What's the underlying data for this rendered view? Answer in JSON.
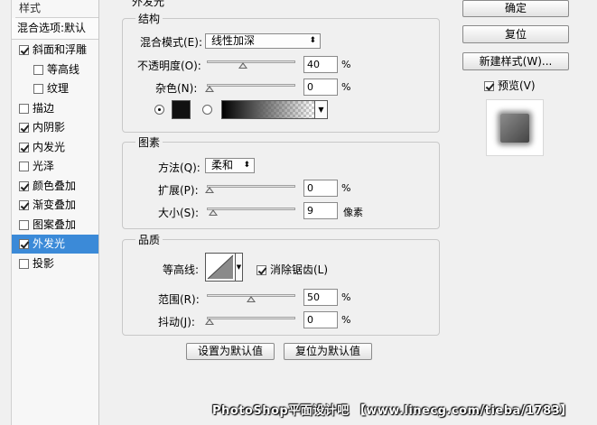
{
  "left": {
    "title": "样式",
    "blending_options": "混合选项:默认",
    "items": [
      {
        "label": "斜面和浮雕",
        "checked": true,
        "indent": false,
        "selected": false
      },
      {
        "label": "等高线",
        "checked": false,
        "indent": true,
        "selected": false
      },
      {
        "label": "纹理",
        "checked": false,
        "indent": true,
        "selected": false
      },
      {
        "label": "描边",
        "checked": false,
        "indent": false,
        "selected": false
      },
      {
        "label": "内阴影",
        "checked": true,
        "indent": false,
        "selected": false
      },
      {
        "label": "内发光",
        "checked": true,
        "indent": false,
        "selected": false
      },
      {
        "label": "光泽",
        "checked": false,
        "indent": false,
        "selected": false
      },
      {
        "label": "颜色叠加",
        "checked": true,
        "indent": false,
        "selected": false
      },
      {
        "label": "渐变叠加",
        "checked": true,
        "indent": false,
        "selected": false
      },
      {
        "label": "图案叠加",
        "checked": false,
        "indent": false,
        "selected": false
      },
      {
        "label": "外发光",
        "checked": true,
        "indent": false,
        "selected": true
      },
      {
        "label": "投影",
        "checked": false,
        "indent": false,
        "selected": false
      }
    ]
  },
  "main": {
    "panel_title": "外发光",
    "structure": {
      "legend": "结构",
      "blend_mode_label": "混合模式(E):",
      "blend_mode_value": "线性加深",
      "opacity_label": "不透明度(O):",
      "opacity_value": "40",
      "opacity_unit": "%",
      "opacity_level": 0.4,
      "noise_label": "杂色(N):",
      "noise_value": "0",
      "noise_unit": "%",
      "noise_level": 0,
      "solid_color": "#111111"
    },
    "elements": {
      "legend": "图素",
      "technique_label": "方法(Q):",
      "technique_value": "柔和",
      "spread_label": "扩展(P):",
      "spread_value": "0",
      "spread_unit": "%",
      "spread_level": 0,
      "size_label": "大小(S):",
      "size_value": "9",
      "size_unit": "像素",
      "size_level": 0.04
    },
    "quality": {
      "legend": "品质",
      "contour_label": "等高线:",
      "antialias_label": "消除锯齿(L)",
      "antialias_checked": true,
      "range_label": "范围(R):",
      "range_value": "50",
      "range_unit": "%",
      "range_level": 0.5,
      "jitter_label": "抖动(J):",
      "jitter_value": "0",
      "jitter_unit": "%",
      "jitter_level": 0
    },
    "make_default": "设置为默认值",
    "reset_default": "复位为默认值"
  },
  "right": {
    "ok": "确定",
    "reset": "复位",
    "new_style": "新建样式(W)...",
    "preview_label": "预览(V)",
    "preview_checked": true
  },
  "watermark": "PhotoShop平面设计吧 【www.linecg.com/tieba/1783】"
}
